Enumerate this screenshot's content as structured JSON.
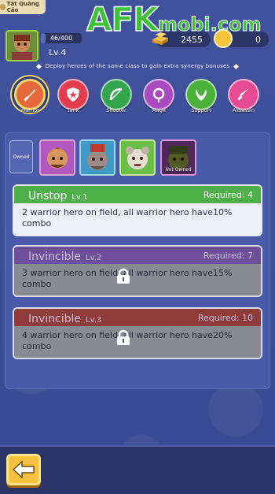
{
  "ad_badge": {
    "label": "Tắt Quảng Cáo"
  },
  "watermark": {
    "big": "AFK",
    "small": "mobi.com"
  },
  "player": {
    "exp_text": "46/400",
    "exp_progress": 0.115,
    "level": "Lv.4"
  },
  "resources": {
    "gold": "2455",
    "gems": "0"
  },
  "hint": "Deploy heroes of the same class to gain extra synergy bonuses",
  "classes": [
    {
      "label": "Warrior",
      "color": "#e6683d",
      "icon": "sword-icon",
      "active": true
    },
    {
      "label": "Tank",
      "color": "#e23d4f",
      "icon": "shield-icon",
      "active": false
    },
    {
      "label": "Shooter",
      "color": "#33a64d",
      "icon": "bow-icon",
      "active": false
    },
    {
      "label": "Mage",
      "color": "#a94bc0",
      "icon": "magic-orb-icon",
      "active": false
    },
    {
      "label": "Support",
      "color": "#4ab23a",
      "icon": "leaf-icon",
      "active": false
    },
    {
      "label": "Assassin",
      "color": "#e64a93",
      "icon": "dagger-icon",
      "active": false
    }
  ],
  "owned_label": "Owned",
  "heroes": [
    {
      "name": "hero-1",
      "owned": true
    },
    {
      "name": "hero-2",
      "owned": true
    },
    {
      "name": "hero-3",
      "owned": true
    },
    {
      "name": "hero-4",
      "owned": false,
      "status": "Not Owned"
    }
  ],
  "bonuses": [
    {
      "name": "Unstop",
      "level": "Lv.1",
      "required": "Required: 4",
      "desc": "2 warrior hero on field, all warrior hero have10% combo",
      "locked": false
    },
    {
      "name": "Invincible",
      "level": "Lv.2",
      "required": "Required: 7",
      "desc": "3 warrior hero on field, all warrior hero have15% combo",
      "locked": true
    },
    {
      "name": "Invincible",
      "level": "Lv.3",
      "required": "Required: 10",
      "desc": "4 warrior hero on field, all warrior hero have20% combo",
      "locked": true
    }
  ],
  "colors": {
    "accent": "#f4c23f",
    "bg": "#3f4f9a"
  }
}
